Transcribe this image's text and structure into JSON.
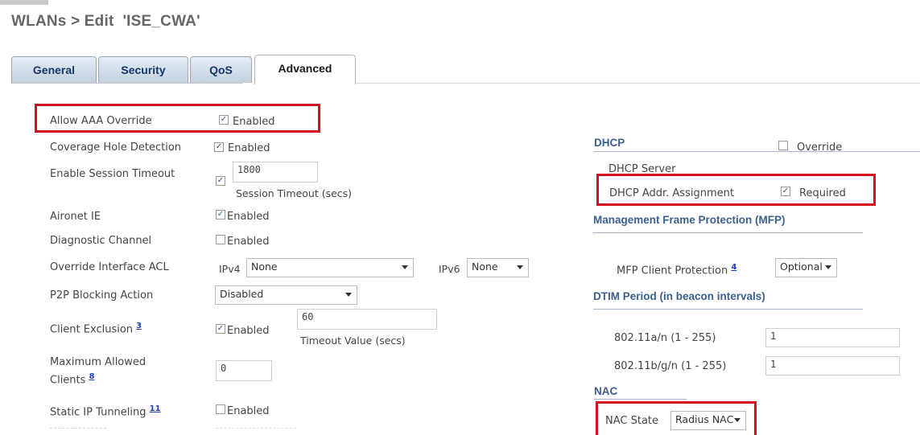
{
  "header": {
    "title": "WLANs > Edit  'ISE_CWA'"
  },
  "tabs": [
    {
      "label": "General"
    },
    {
      "label": "Security"
    },
    {
      "label": "QoS"
    },
    {
      "label": "Advanced"
    }
  ],
  "left": {
    "allow_aaa_override": {
      "label": "Allow AAA Override",
      "checkbox_label": "Enabled",
      "checked": true
    },
    "coverage_hole": {
      "label": "Coverage Hole Detection",
      "checkbox_label": "Enabled",
      "checked": true
    },
    "session_timeout": {
      "label": "Enable Session Timeout",
      "value": "1800",
      "caption": "Session Timeout (secs)",
      "checked": true
    },
    "aironet_ie": {
      "label": "Aironet IE",
      "checkbox_label": "Enabled",
      "checked": true
    },
    "diagnostic_channel": {
      "label": "Diagnostic Channel",
      "checkbox_label": "Enabled",
      "checked": false
    },
    "override_acl": {
      "label": "Override Interface ACL",
      "ipv4_label": "IPv4",
      "ipv4_value": "None",
      "ipv6_label": "IPv6",
      "ipv6_value": "None"
    },
    "p2p_blocking": {
      "label": "P2P Blocking Action",
      "value": "Disabled"
    },
    "client_exclusion": {
      "label": "Client Exclusion",
      "footnote": "3",
      "checkbox_label": "Enabled",
      "checked": true,
      "value": "60",
      "caption": "Timeout Value (secs)"
    },
    "max_clients": {
      "label_line1": "Maximum Allowed",
      "label_line2": "Clients",
      "footnote": "8",
      "value": "0"
    },
    "static_ip": {
      "label": "Static IP Tunneling",
      "footnote": "11",
      "checkbox_label": "Enabled",
      "checked": false
    }
  },
  "right": {
    "dhcp_header": "DHCP",
    "dhcp_server": {
      "label": "DHCP Server",
      "checkbox_label": "Override",
      "checked": false
    },
    "dhcp_addr": {
      "label": "DHCP Addr. Assignment",
      "checkbox_label": "Required",
      "checked": true
    },
    "mfp_header": "Management Frame Protection (MFP)",
    "mfp_client": {
      "label": "MFP Client Protection",
      "footnote": "4",
      "value": "Optional"
    },
    "dtim_header": "DTIM Period (in beacon intervals)",
    "dtim_a": {
      "label": "802.11a/n (1 - 255)",
      "value": "1"
    },
    "dtim_b": {
      "label": "802.11b/g/n (1 - 255)",
      "value": "1"
    },
    "nac_header": "NAC",
    "nac_state": {
      "label": "NAC State",
      "value": "Radius NAC"
    }
  },
  "colors": {
    "highlight": "#d4111f",
    "tab_text": "#14376b",
    "section_header": "#3c5f8c"
  }
}
